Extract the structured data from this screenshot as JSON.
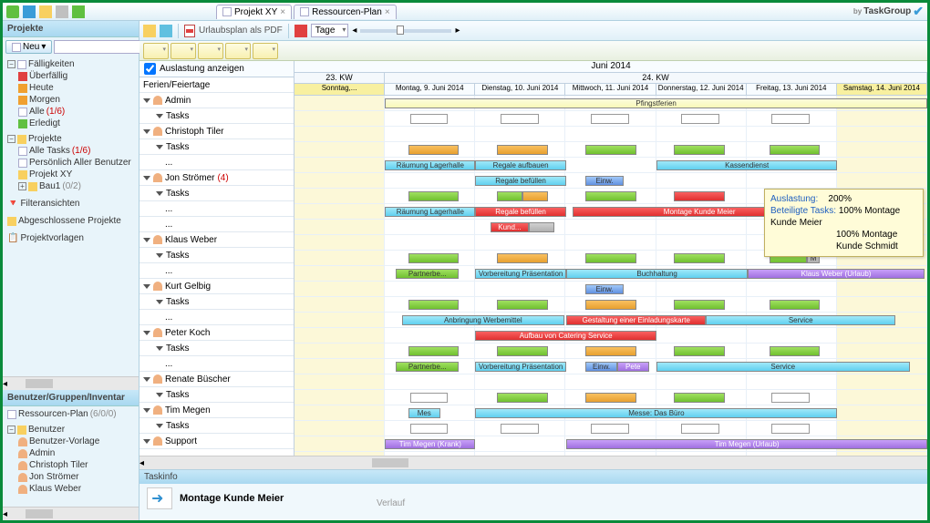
{
  "logo": "TaskGroup",
  "tabs": [
    {
      "label": "Projekt XY",
      "active": false
    },
    {
      "label": "Ressourcen-Plan",
      "active": true
    }
  ],
  "sidebar": {
    "sec_projekte": "Projekte",
    "btn_new": "Neu",
    "falligkeiten": {
      "title": "Fälligkeiten",
      "items": [
        "Überfällig",
        "Heute",
        "Morgen"
      ],
      "alle": "Alle",
      "alle_cnt": "(1/6)",
      "erledigt": "Erledigt"
    },
    "projekte_tree": {
      "title": "Projekte",
      "alle_tasks": "Alle Tasks",
      "alle_tasks_cnt": "(1/6)",
      "pers": "Persönlich Aller Benutzer",
      "pxy": "Projekt XY",
      "bau1": "Bau1",
      "bau1_cnt": "(0/2)"
    },
    "filter": "Filteransichten",
    "abg": "Abgeschlossene Projekte",
    "pvl": "Projektvorlagen",
    "sec_benutzer": "Benutzer/Gruppen/Inventar",
    "rplan": "Ressourcen-Plan",
    "rplan_cnt": "(6/0/0)",
    "benutzer": {
      "title": "Benutzer",
      "items": [
        "Benutzer-Vorlage",
        "Admin",
        "Christoph Tiler",
        "Jon Strömer",
        "Klaus Weber"
      ]
    }
  },
  "ctoolbar": {
    "pdf": "Urlaubsplan als PDF",
    "scale": "Tage"
  },
  "chk_auslastung": "Auslastung anzeigen",
  "gantt": {
    "month": "Juni 2014",
    "kw": [
      "23. KW",
      "24. KW"
    ],
    "days": [
      {
        "label": "Sonntag,...",
        "we": true
      },
      {
        "label": "Montag, 9. Juni 2014",
        "we": false
      },
      {
        "label": "Dienstag, 10. Juni 2014",
        "we": false
      },
      {
        "label": "Mittwoch, 11. Juni 2014",
        "we": false
      },
      {
        "label": "Donnerstag, 12. Juni 2014",
        "we": false
      },
      {
        "label": "Freitag, 13. Juni 2014",
        "we": false
      },
      {
        "label": "Samstag, 14. Juni 2014",
        "we": true
      }
    ],
    "resources": [
      {
        "name": "Ferien/Feiertage",
        "type": "hdr"
      },
      {
        "name": "Admin",
        "type": "user"
      },
      {
        "name": "Tasks",
        "type": "sub"
      },
      {
        "name": "Christoph Tiler",
        "type": "user"
      },
      {
        "name": "Tasks",
        "type": "sub"
      },
      {
        "name": "...",
        "type": "dots"
      },
      {
        "name": "Jon Strömer",
        "type": "user",
        "cnt": "(4)"
      },
      {
        "name": "Tasks",
        "type": "sub"
      },
      {
        "name": "...",
        "type": "dots"
      },
      {
        "name": "...",
        "type": "dots"
      },
      {
        "name": "Klaus Weber",
        "type": "user"
      },
      {
        "name": "Tasks",
        "type": "sub"
      },
      {
        "name": "...",
        "type": "dots"
      },
      {
        "name": "Kurt Gelbig",
        "type": "user"
      },
      {
        "name": "Tasks",
        "type": "sub"
      },
      {
        "name": "...",
        "type": "dots"
      },
      {
        "name": "Peter Koch",
        "type": "user"
      },
      {
        "name": "Tasks",
        "type": "sub"
      },
      {
        "name": "...",
        "type": "dots"
      },
      {
        "name": "Renate Büscher",
        "type": "user"
      },
      {
        "name": "Tasks",
        "type": "sub"
      },
      {
        "name": "Tim Megen",
        "type": "user"
      },
      {
        "name": "Tasks",
        "type": "sub"
      },
      {
        "name": "Support",
        "type": "user"
      }
    ],
    "bars_text": {
      "pfingstferien": "Pfingstferien",
      "raumung": "Räumung Lagerhalle",
      "regale_auf": "Regale aufbauen",
      "regale_bef": "Regale befüllen",
      "kassen": "Kassendienst",
      "einw": "Einw.",
      "kund": "Kund...",
      "montage_meier": "Montage Kunde Meier",
      "partner": "Partnerbe...",
      "vorb": "Vorbereitung Präsentation",
      "buch": "Buchhaltung",
      "klaus_urlaub": "Klaus Weber (Urlaub)",
      "anbr": "Anbringung Werbemittel",
      "gest": "Gestaltung einer Einladungskarte",
      "aufbau": "Aufbau von Catering Service",
      "service": "Service",
      "pete": "Pete",
      "mes": "Mes",
      "messe": "Messe: Das Büro",
      "tim_krank": "Tim Megen (Krank)",
      "tim_urlaub": "Tim Megen (Urlaub)",
      "m": "M"
    }
  },
  "tooltip": {
    "auslastung_lbl": "Auslastung:",
    "auslastung_val": "200%",
    "bet_lbl": "Beteiligte Tasks:",
    "bet_val1": "100% Montage Kunde Meier",
    "bet_val2": "100% Montage Kunde Schmidt"
  },
  "taskinfo": {
    "hdr": "Taskinfo",
    "title": "Montage Kunde Meier",
    "verlauf": "Verlauf"
  }
}
